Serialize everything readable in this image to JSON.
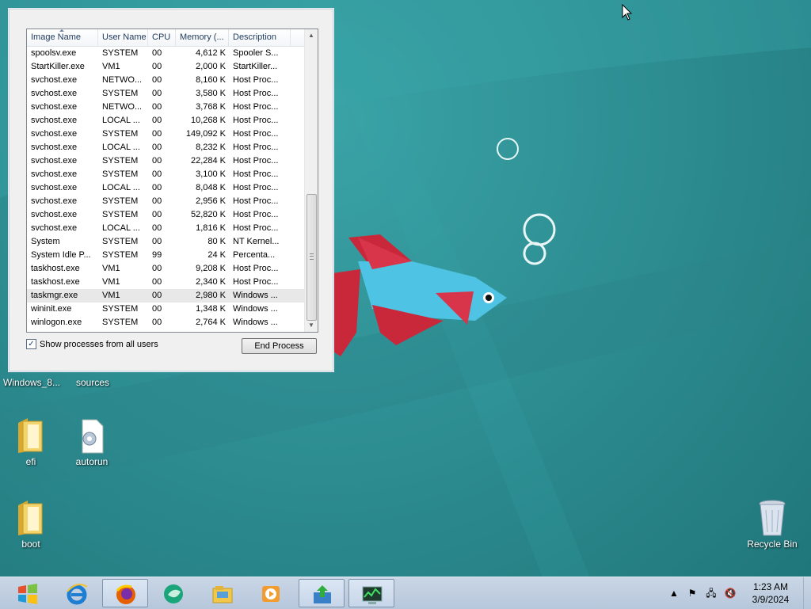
{
  "task_manager": {
    "columns": [
      "Image Name",
      "User Name",
      "CPU",
      "Memory (...",
      "Description"
    ],
    "rows": [
      {
        "name": "spoolsv.exe",
        "user": "SYSTEM",
        "cpu": "00",
        "mem": "4,612 K",
        "desc": "Spooler S..."
      },
      {
        "name": "StartKiller.exe",
        "user": "VM1",
        "cpu": "00",
        "mem": "2,000 K",
        "desc": "StartKiller..."
      },
      {
        "name": "svchost.exe",
        "user": "NETWO...",
        "cpu": "00",
        "mem": "8,160 K",
        "desc": "Host Proc..."
      },
      {
        "name": "svchost.exe",
        "user": "SYSTEM",
        "cpu": "00",
        "mem": "3,580 K",
        "desc": "Host Proc..."
      },
      {
        "name": "svchost.exe",
        "user": "NETWO...",
        "cpu": "00",
        "mem": "3,768 K",
        "desc": "Host Proc..."
      },
      {
        "name": "svchost.exe",
        "user": "LOCAL ...",
        "cpu": "00",
        "mem": "10,268 K",
        "desc": "Host Proc..."
      },
      {
        "name": "svchost.exe",
        "user": "SYSTEM",
        "cpu": "00",
        "mem": "149,092 K",
        "desc": "Host Proc..."
      },
      {
        "name": "svchost.exe",
        "user": "LOCAL ...",
        "cpu": "00",
        "mem": "8,232 K",
        "desc": "Host Proc..."
      },
      {
        "name": "svchost.exe",
        "user": "SYSTEM",
        "cpu": "00",
        "mem": "22,284 K",
        "desc": "Host Proc..."
      },
      {
        "name": "svchost.exe",
        "user": "SYSTEM",
        "cpu": "00",
        "mem": "3,100 K",
        "desc": "Host Proc..."
      },
      {
        "name": "svchost.exe",
        "user": "LOCAL ...",
        "cpu": "00",
        "mem": "8,048 K",
        "desc": "Host Proc..."
      },
      {
        "name": "svchost.exe",
        "user": "SYSTEM",
        "cpu": "00",
        "mem": "2,956 K",
        "desc": "Host Proc..."
      },
      {
        "name": "svchost.exe",
        "user": "SYSTEM",
        "cpu": "00",
        "mem": "52,820 K",
        "desc": "Host Proc..."
      },
      {
        "name": "svchost.exe",
        "user": "LOCAL ...",
        "cpu": "00",
        "mem": "1,816 K",
        "desc": "Host Proc..."
      },
      {
        "name": "System",
        "user": "SYSTEM",
        "cpu": "00",
        "mem": "80 K",
        "desc": "NT Kernel..."
      },
      {
        "name": "System Idle P...",
        "user": "SYSTEM",
        "cpu": "99",
        "mem": "24 K",
        "desc": "Percenta..."
      },
      {
        "name": "taskhost.exe",
        "user": "VM1",
        "cpu": "00",
        "mem": "9,208 K",
        "desc": "Host Proc..."
      },
      {
        "name": "taskhost.exe",
        "user": "VM1",
        "cpu": "00",
        "mem": "2,340 K",
        "desc": "Host Proc..."
      },
      {
        "name": "taskmgr.exe",
        "user": "VM1",
        "cpu": "00",
        "mem": "2,980 K",
        "desc": "Windows ...",
        "selected": true
      },
      {
        "name": "wininit.exe",
        "user": "SYSTEM",
        "cpu": "00",
        "mem": "1,348 K",
        "desc": "Windows ..."
      },
      {
        "name": "winlogon.exe",
        "user": "SYSTEM",
        "cpu": "00",
        "mem": "2,764 K",
        "desc": "Windows ..."
      }
    ],
    "sorted_column": "Image Name",
    "show_all_label": "Show processes from all users",
    "show_all_checked": true,
    "end_process_label": "End Process",
    "scroll_position_fraction": 0.6
  },
  "desktop_icons": [
    {
      "label": "Windows_8...",
      "icon": "folder-icon"
    },
    {
      "label": "sources",
      "icon": "folder-icon"
    },
    {
      "label": "efi",
      "icon": "folder-icon"
    },
    {
      "label": "autorun",
      "icon": "settings-file-icon"
    },
    {
      "label": "boot",
      "icon": "folder-icon"
    },
    {
      "label": "Recycle Bin",
      "icon": "recycle-bin-icon"
    }
  ],
  "taskbar": {
    "apps": [
      {
        "name": "start-button",
        "icon": "windows-logo-icon"
      },
      {
        "name": "internet-explorer",
        "icon": "ie-icon"
      },
      {
        "name": "firefox",
        "icon": "firefox-icon"
      },
      {
        "name": "app-green",
        "icon": "green-app-icon"
      },
      {
        "name": "file-explorer",
        "icon": "folder-icon"
      },
      {
        "name": "media-player",
        "icon": "media-icon"
      },
      {
        "name": "install-app",
        "icon": "install-icon"
      },
      {
        "name": "task-manager",
        "icon": "task-manager-icon"
      }
    ],
    "clock_time": "1:23 AM",
    "clock_date": "3/9/2024"
  },
  "colors": {
    "desktop": "#2e8f93",
    "fish_blue": "#4fc3e4",
    "fish_red": "#c8283a",
    "taskbar": "#bfcde0"
  }
}
